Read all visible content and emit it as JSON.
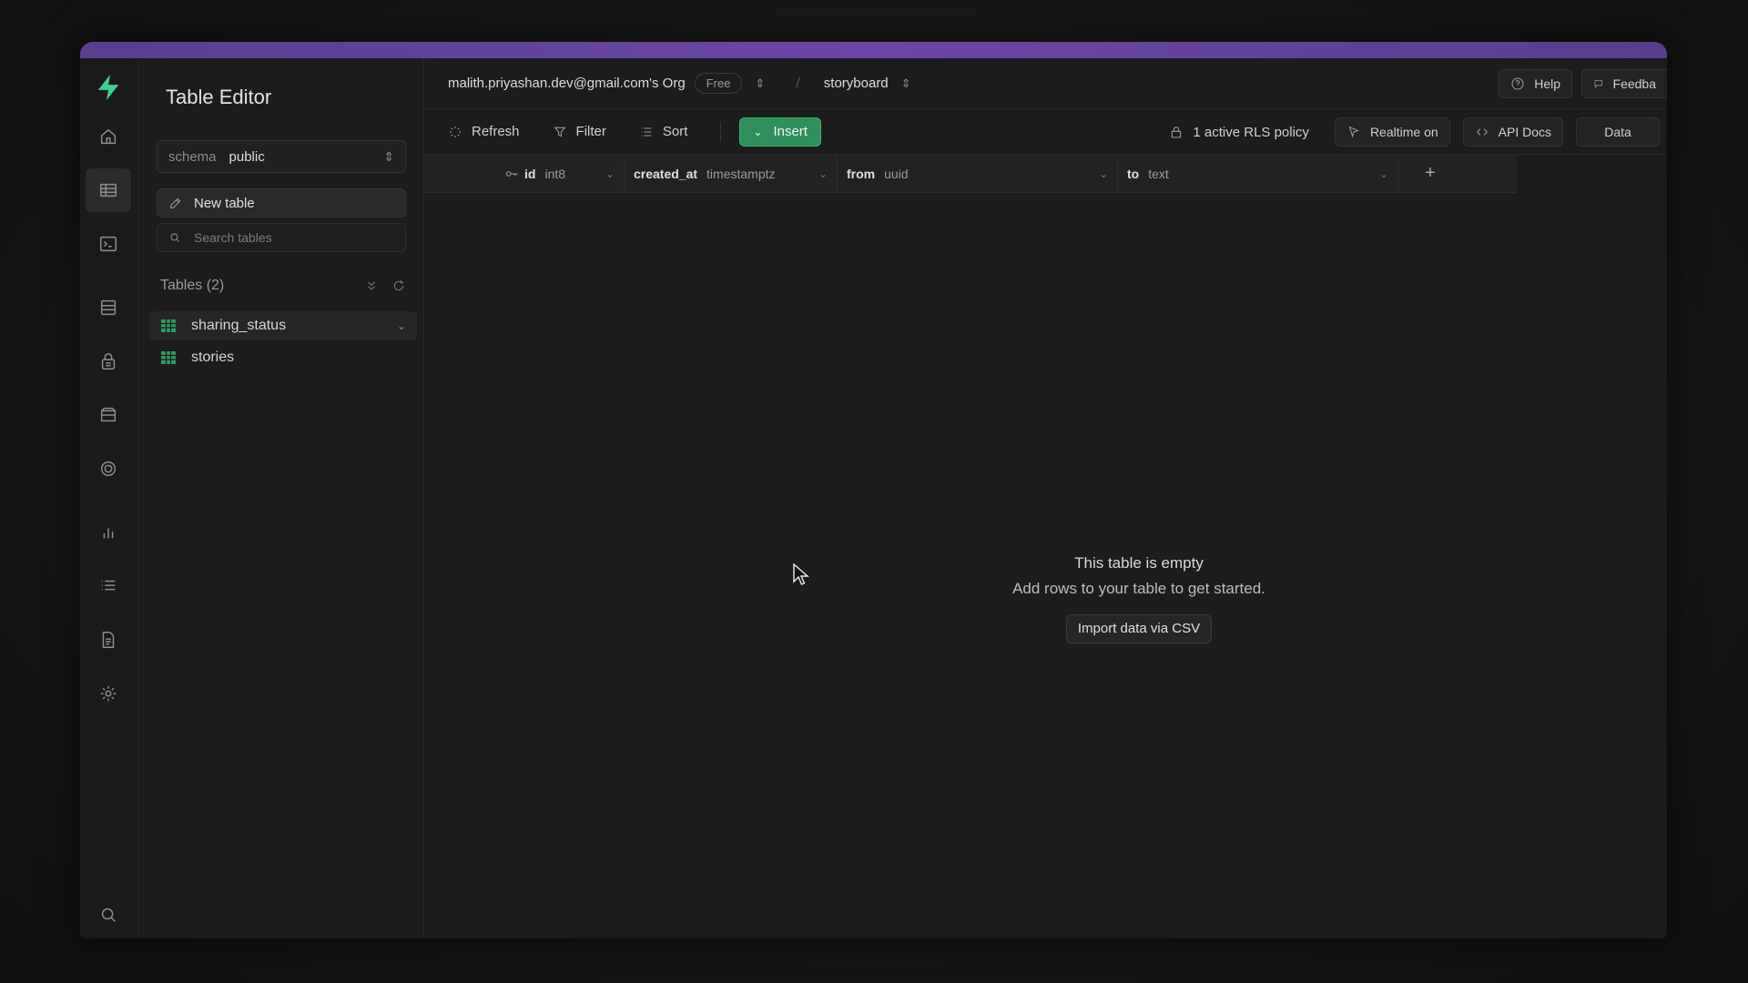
{
  "sidebar": {
    "title": "Table Editor",
    "schema": {
      "label": "schema",
      "value": "public"
    },
    "new_table_label": "New table",
    "search_placeholder": "Search tables",
    "tables_header": "Tables (2)",
    "tables": [
      {
        "name": "sharing_status",
        "selected": true
      },
      {
        "name": "stories",
        "selected": false
      }
    ]
  },
  "topbar": {
    "org": "malith.priyashan.dev@gmail.com's Org",
    "plan_badge": "Free",
    "separator": "/",
    "project": "storyboard",
    "help_label": "Help",
    "feedback_label": "Feedba"
  },
  "toolbar": {
    "refresh_label": "Refresh",
    "filter_label": "Filter",
    "sort_label": "Sort",
    "insert_label": "Insert",
    "rls_label": "1 active RLS policy",
    "realtime_label": "Realtime on",
    "api_docs_label": "API Docs",
    "data_label": "Data"
  },
  "columns": [
    {
      "name": "id",
      "type": "int8",
      "primary_key": true
    },
    {
      "name": "created_at",
      "type": "timestamptz"
    },
    {
      "name": "from",
      "type": "uuid"
    },
    {
      "name": "to",
      "type": "text"
    }
  ],
  "empty_state": {
    "title": "This table is empty",
    "subtitle": "Add rows to your table to get started.",
    "import_label": "Import data via CSV"
  },
  "colors": {
    "accent_green": "#2f8f5b",
    "brand_green": "#3ecf8e",
    "window_top_bar": "#6a46a6"
  },
  "icons": {
    "rail": [
      "home-icon",
      "table-editor-icon",
      "sql-editor-icon",
      "database-icon",
      "auth-icon",
      "storage-icon",
      "realtime-icon",
      "reports-icon",
      "logs-icon",
      "docs-icon",
      "settings-icon",
      "search-icon"
    ]
  }
}
